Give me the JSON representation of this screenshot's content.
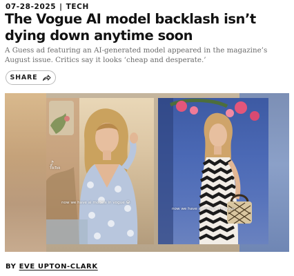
{
  "article": {
    "date": "07-28-2025",
    "separator": "|",
    "category": "TECH",
    "headline": "The Vogue AI model backlash isn’t dying down anytime soon",
    "dek": "A Guess ad featuring an AI-generated model appeared in the magazine’s August issue. Critics say it looks ‘cheap and desperate.’",
    "share_label": "SHARE",
    "share_icon": "share-arrow-icon",
    "byline_prefix": "BY",
    "author": "EVE UPTON-CLARK"
  },
  "media": {
    "left_caption": "now we have ai models in vogue",
    "right_caption": "now we have ai models in vogue",
    "left_emoji": "😭",
    "tiktok_mark": "♪",
    "tiktok_label": "TikTok"
  }
}
